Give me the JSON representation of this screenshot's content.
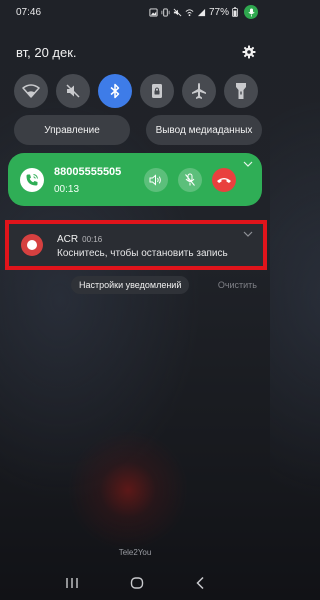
{
  "status_bar": {
    "time": "07:46",
    "battery": "77%",
    "icons": [
      "gallery-icon",
      "vibrate-icon",
      "mute-icon",
      "wifi-calling-icon",
      "signal-icon",
      "battery-icon"
    ],
    "mic_color": "#2fa84f"
  },
  "header": {
    "date": "вт, 20 дек.",
    "settings_icon": "gear-icon"
  },
  "quick_settings": {
    "tiles": [
      {
        "name": "wifi-icon",
        "active": false
      },
      {
        "name": "sound-off-icon",
        "active": false
      },
      {
        "name": "bluetooth-icon",
        "active": true
      },
      {
        "name": "lock-icon",
        "active": false
      },
      {
        "name": "airplane-icon",
        "active": false
      },
      {
        "name": "flashlight-icon",
        "active": false
      }
    ],
    "control_label": "Управление",
    "media_output_label": "Вывод медиаданных",
    "active_color": "#3e7ce8"
  },
  "call": {
    "number": "88005555505",
    "duration": "00:13",
    "accent": "#2fae56",
    "end_color": "#e9403e"
  },
  "notification": {
    "app": "ACR",
    "time": "00:16",
    "body": "Коснитесь, чтобы остановить запись",
    "highlight_color": "#e0141b"
  },
  "notif_actions": {
    "settings_label": "Настройки уведомлений",
    "clear_label": "Очистить"
  },
  "footer": {
    "carrier": "Tele2You"
  }
}
